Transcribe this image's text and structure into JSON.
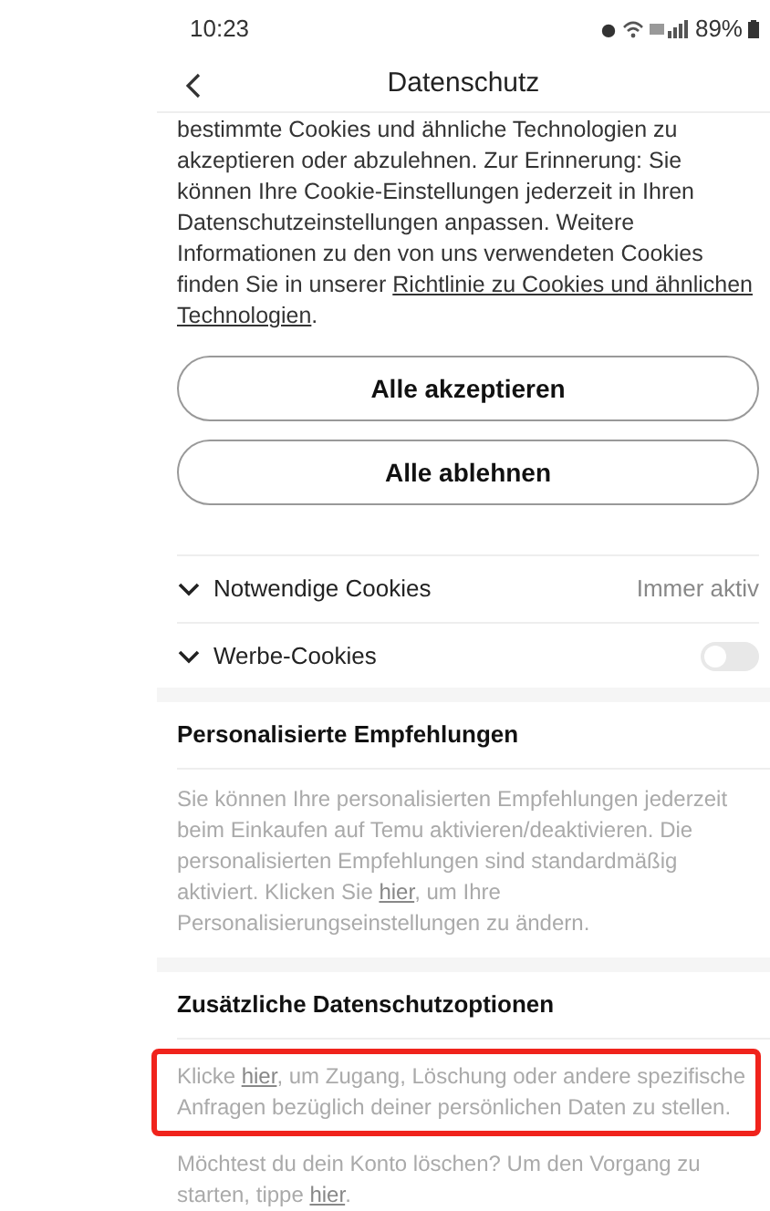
{
  "status_bar": {
    "time": "10:23",
    "battery": "89%"
  },
  "header": {
    "title": "Datenschutz"
  },
  "intro": {
    "parts": [
      {
        "text": "bestimmte Cookies und ähnliche Technologien zu akzeptieren oder abzulehnen. Zur Erinnerung: Sie können Ihre Cookie-Einstellungen jederzeit in Ihren Datenschutzeinstellungen anpassen. Weitere Informationen zu den von uns verwendeten Cookies finden Sie in unserer "
      },
      {
        "text": "Richtlinie zu Cookies und ähnlichen",
        "link": true
      },
      {
        "text": "Technologien",
        "link": true
      },
      {
        "text": "."
      }
    ]
  },
  "buttons": [
    "Alle akzeptieren",
    "Alle ablehnen"
  ],
  "cookie_rows": [
    {
      "label": "Notwendige Cookies",
      "kind": "status",
      "status": "Immer aktiv"
    },
    {
      "label": "Werbe-Cookies",
      "kind": "toggle",
      "on": false
    }
  ],
  "sections": [
    {
      "title": "Personalisierte Empfehlungen",
      "paragraphs": [
        {
          "highlighted": false,
          "parts": [
            {
              "text": "Sie können Ihre personalisierten Empfehlungen jederzeit beim Einkaufen auf Temu aktivieren/deaktivieren. Die personalisierten Empfehlungen sind standardmäßig aktiviert. Klicken Sie "
            },
            {
              "text": "hier",
              "link": true
            },
            {
              "text": ", um Ihre Personalisierungseinstellungen zu ändern."
            }
          ]
        }
      ]
    },
    {
      "title": "Zusätzliche Datenschutzoptionen",
      "paragraphs": [
        {
          "highlighted": true,
          "parts": [
            {
              "text": "Klicke "
            },
            {
              "text": "hier",
              "link": true
            },
            {
              "text": ", um Zugang, Löschung oder andere spezifische Anfragen bezüglich deiner persönlichen Daten zu stellen."
            }
          ]
        },
        {
          "highlighted": false,
          "parts": [
            {
              "text": "Möchtest du dein Konto löschen? Um den Vorgang zu starten, tippe "
            },
            {
              "text": "hier",
              "link": true
            },
            {
              "text": "."
            }
          ]
        }
      ]
    }
  ]
}
